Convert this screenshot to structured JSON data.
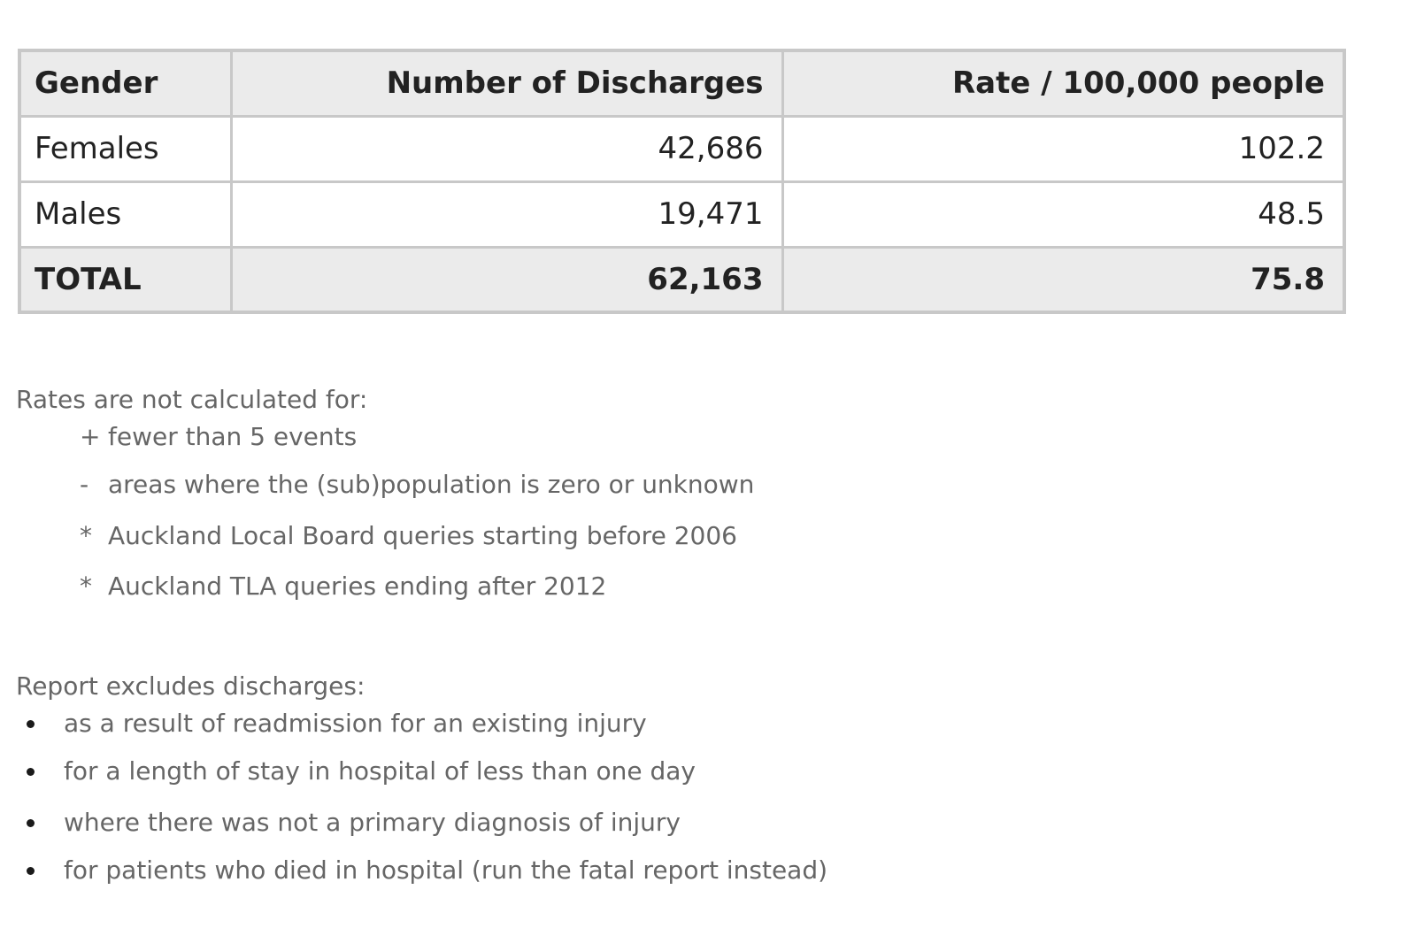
{
  "table": {
    "columns": [
      "Gender",
      "Number of Discharges",
      "Rate / 100,000 people"
    ],
    "rows": [
      {
        "gender": "Females",
        "discharges": "42,686",
        "rate": "102.2"
      },
      {
        "gender": "Males",
        "discharges": "19,471",
        "rate": "48.5"
      }
    ],
    "total": {
      "gender": "TOTAL",
      "discharges": "62,163",
      "rate": "75.8"
    }
  },
  "rate_exclusions": {
    "heading": "Rates are not calculated for:",
    "items": [
      {
        "symbol": "+",
        "text": "fewer than 5 events"
      },
      {
        "symbol": "-",
        "text": "areas where the (sub)population is zero or unknown"
      },
      {
        "symbol": "*",
        "text": "Auckland Local Board queries starting before 2006"
      },
      {
        "symbol": "*",
        "text": "Auckland TLA queries ending after 2012"
      }
    ]
  },
  "report_exclusions": {
    "heading": "Report excludes discharges:",
    "items": [
      "as a result of readmission for an existing injury",
      "for a length of stay in hospital of less than one day",
      "where there was not a primary diagnosis of injury",
      "for patients who died in hospital (run the fatal report instead)"
    ]
  },
  "colors": {
    "text": "#222222",
    "note_text": "#666666",
    "header_bg": "#ebebeb",
    "border": "#c8c8c8",
    "bullet": "#1a1a1a"
  }
}
